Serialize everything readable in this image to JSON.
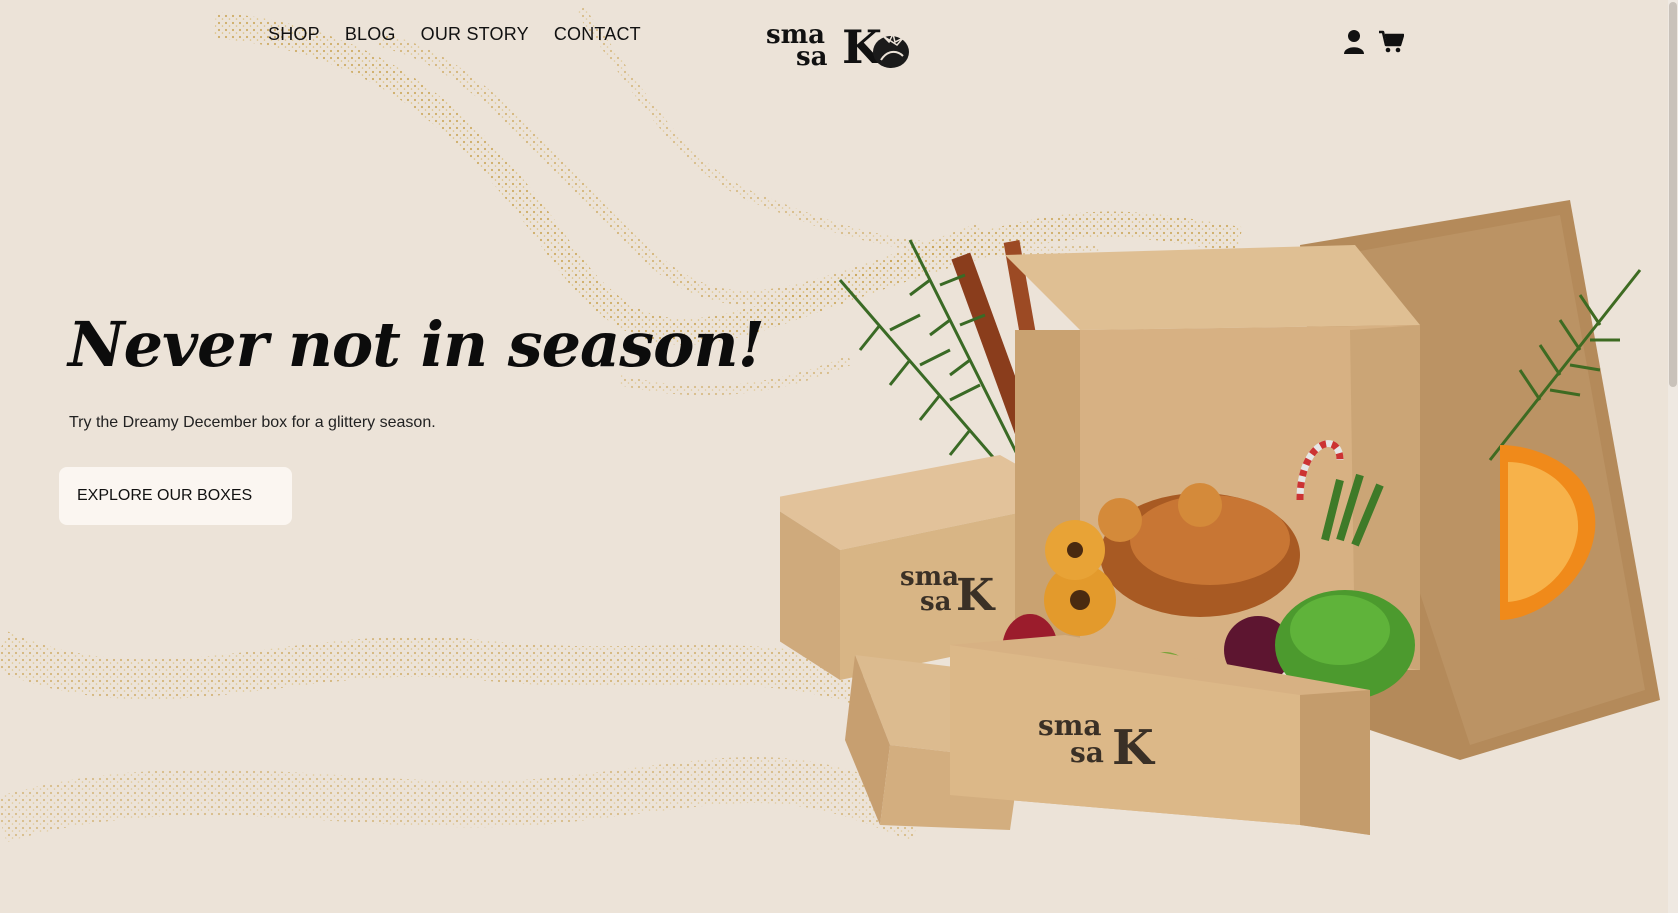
{
  "nav": {
    "items": [
      {
        "label": "SHOP"
      },
      {
        "label": "BLOG"
      },
      {
        "label": "OUR STORY"
      },
      {
        "label": "CONTACT"
      }
    ]
  },
  "logo": {
    "line1": "sma",
    "line2": "sa",
    "mark": "K"
  },
  "header_icons": [
    {
      "name": "user-icon"
    },
    {
      "name": "cart-icon"
    }
  ],
  "hero": {
    "title": "Never not in season!",
    "subtitle": "Try the Dreamy December box for a glittery season.",
    "cta_label": "EXPLORE OUR BOXES"
  },
  "box_branding": {
    "line1": "sma",
    "line2": "sa",
    "mark": "K"
  },
  "colors": {
    "background": "#ece3d8",
    "glitter": "#c9a352",
    "button_bg": "#fbf6f1",
    "box_kraft": "#d7b183",
    "text": "#111111"
  }
}
